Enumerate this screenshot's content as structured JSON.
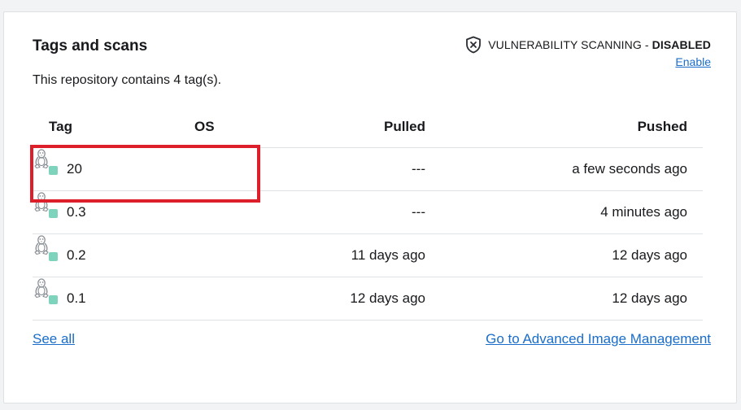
{
  "panel": {
    "title": "Tags and scans",
    "scan_label": "VULNERABILITY SCANNING - ",
    "scan_state": "DISABLED",
    "enable_link": "Enable",
    "summary": "This repository contains 4 tag(s)."
  },
  "table": {
    "headers": {
      "tag": "Tag",
      "os": "OS",
      "pulled": "Pulled",
      "pushed": "Pushed"
    },
    "rows": [
      {
        "tag": "20",
        "os_icon": "linux-icon",
        "pulled": "---",
        "pushed": "a few seconds ago"
      },
      {
        "tag": "0.3",
        "os_icon": "linux-icon",
        "pulled": "---",
        "pushed": "4 minutes ago"
      },
      {
        "tag": "0.2",
        "os_icon": "linux-icon",
        "pulled": "11 days ago",
        "pushed": "12 days ago"
      },
      {
        "tag": "0.1",
        "os_icon": "linux-icon",
        "pulled": "12 days ago",
        "pushed": "12 days ago"
      }
    ]
  },
  "footer": {
    "see_all": "See all",
    "advanced_link": "Go to Advanced Image Management"
  },
  "colors": {
    "link": "#1a6dc9",
    "tag_dot": "#7ed3bd",
    "highlight": "#dd1f2b"
  }
}
